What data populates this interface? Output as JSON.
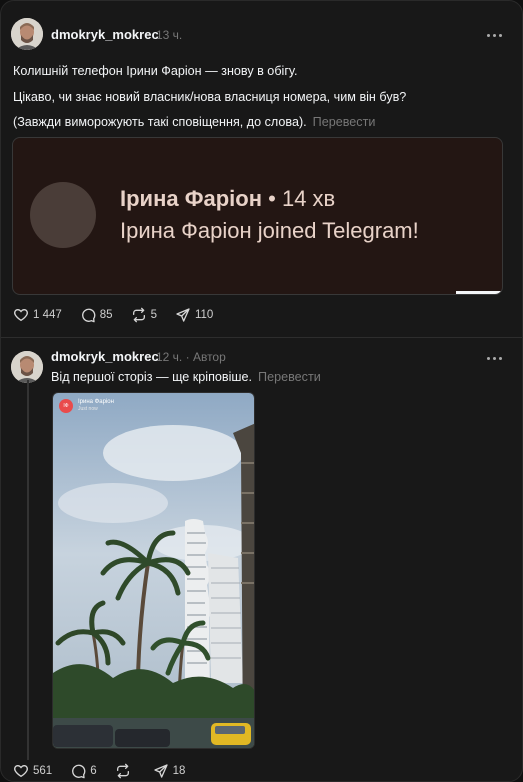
{
  "post1": {
    "username": "dmokryk_mokrec",
    "time": "13 ч.",
    "lines": [
      "Колишній телефон Ірини Фаріон — знову в обігу.",
      "Цікаво, чи знає новий власник/нова власниця номера, чим він був?",
      "(Завжди виморожують такі сповіщення, до слова)."
    ],
    "translate": "Перевести",
    "notification": {
      "name": "Ірина Фаріон",
      "time": "• 14 хв",
      "message": "Ірина Фаріон joined Telegram!"
    },
    "likes": "1 447",
    "comments": "85",
    "reposts": "5",
    "shares": "110"
  },
  "post2": {
    "username": "dmokryk_mokrec",
    "time": "12 ч.",
    "author_badge": "· Автор",
    "text": "Від першої сторіз — ще кріповіше.",
    "translate": "Перевести",
    "story": {
      "avatar_initials": "ІФ",
      "name": "Ірина Фаріон",
      "time": "Just now"
    },
    "likes": "561",
    "comments": "6",
    "reposts": "",
    "shares": "18"
  }
}
